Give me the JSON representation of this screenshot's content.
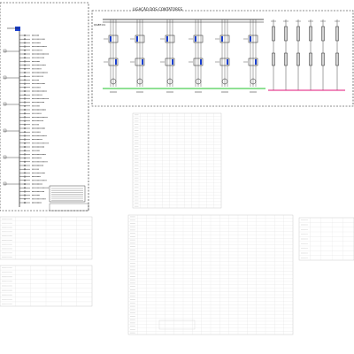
{
  "drawing": {
    "title": "LIGAÇÃO DOS CONTATORES",
    "panel_label": "QGBT-01"
  },
  "colors": {
    "line": "#1a1a1a",
    "ground_bus": "#22c32a",
    "neutral_bus": "#e0147a",
    "device_blue": "#1a3fd0",
    "faded_table": "#c9c9c9"
  },
  "icons": [
    "contactor-icon",
    "breaker-icon",
    "motor-icon"
  ],
  "tables": [
    {
      "id": "quadro-de-cargas-1"
    },
    {
      "id": "quadro-de-cargas-2"
    },
    {
      "id": "quadro-de-cargas-3"
    },
    {
      "id": "quadro-de-cargas-4"
    },
    {
      "id": "resumo-de-cargas"
    }
  ]
}
